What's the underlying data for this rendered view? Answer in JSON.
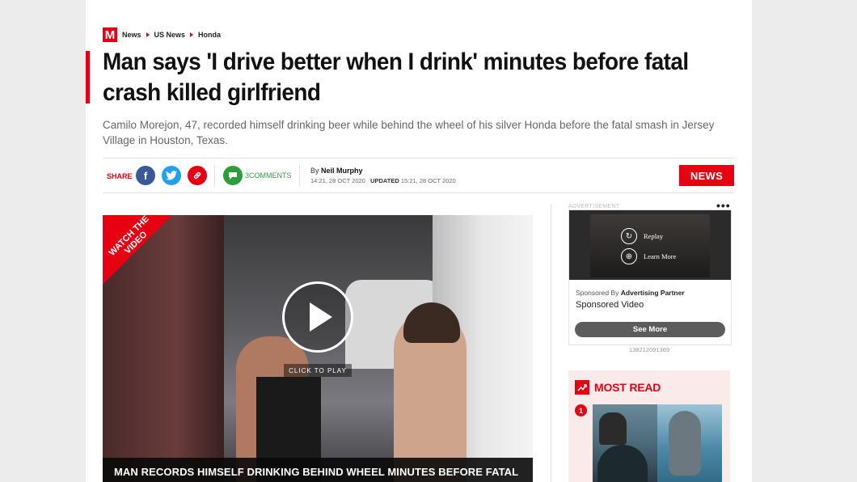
{
  "breadcrumb": {
    "logo": "M",
    "items": [
      "News",
      "US News",
      "Honda"
    ]
  },
  "article": {
    "headline": "Man says 'I drive better when I drink' minutes before fatal crash killed girlfriend",
    "standfirst": "Camilo Morejon, 47, recorded himself drinking beer while behind the wheel of his silver Honda before the fatal smash in Jersey Village in Houston, Texas."
  },
  "share": {
    "label": "SHARE",
    "facebook_icon": "f",
    "twitter_icon": "t",
    "link_icon": "🔗",
    "comments_count": "3",
    "comments_label": "COMMENTS"
  },
  "byline": {
    "by": "By",
    "author": "Neil Murphy",
    "published": "14:21, 28 OCT 2020",
    "updated_label": "UPDATED",
    "updated": "15:21, 28 OCT 2020"
  },
  "section_tag": "NEWS",
  "video": {
    "badge": "WATCH THE VIDEO",
    "click_to_play": "CLICK TO PLAY",
    "caption": "MAN RECORDS HIMSELF DRINKING BEHIND WHEEL MINUTES BEFORE FATAL CRASH"
  },
  "advert": {
    "label": "ADVERTISEMENT",
    "menu": "•••",
    "replay": "Replay",
    "learn_more": "Learn More",
    "sponsored_by_label": "Sponsored By",
    "sponsored_by": "Advertising Partner",
    "title": "Sponsored Video",
    "cta": "See More",
    "id": "138212091369"
  },
  "most_read": {
    "title": "MOST READ",
    "first_rank": "1"
  },
  "colors": {
    "brand_red": "#e60012",
    "facebook": "#3b5998",
    "twitter": "#1da1f2",
    "comments_green": "#2e9e3a"
  }
}
